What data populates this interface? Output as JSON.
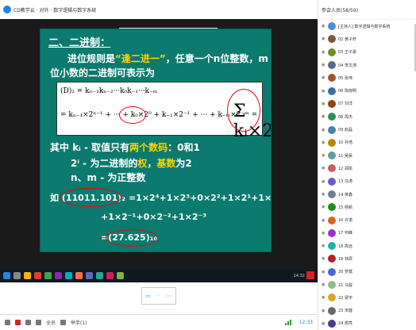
{
  "window": {
    "title": "CD教学云 · 对外 · 数字逻辑与数字系统"
  },
  "slide_header": {
    "left": "放映幻灯片",
    "mid": "课件",
    "right": "屏幕共享·工具"
  },
  "slide": {
    "section_title": "二、二进制：",
    "rule_prefix": "进位规则是",
    "rule_highlight": "“逢二进一”",
    "rule_suffix": "，任意一个n位整数，m",
    "rule_line2": "位小数的二进制可表示为",
    "formula_line1": "(D)₂ = kₙ₋₁kₙ₋₂···k₀k₋₁···k₋ₘ",
    "formula_line2": "= kₙ₋₁×2ⁿ⁻¹ + ··· + k₀×2⁰ + k₋₁×2⁻¹ + ··· + k₋ₘ×2⁻ᵐ =",
    "formula_sum": "Σ kᵢ×2ⁱ",
    "where_prefix": "其中",
    "where_ki": "kᵢ - 取值只有",
    "where_two_digits": "两个数码",
    "where_digits": "：0和1",
    "line3_a": "2ⁱ - 为二进制的",
    "line3_weight": "权",
    "line3_sep": "，",
    "line3_base": "基数",
    "line3_end": "为2",
    "line4": "n、m - 为正整数",
    "example_prefix": "如",
    "example_line1": "(11011.101)₂ =1×2⁴+1×2³+0×2²+1×2¹+1×2⁰",
    "example_line2": "+1×2⁻¹+0×2⁻²+1×2⁻³",
    "example_line3": "=(27.625)₁₀"
  },
  "taskbar": {
    "clock": "14:32"
  },
  "share_bar": {
    "left": "▭",
    "mid": "·",
    "right": "⋯"
  },
  "bottombar": {
    "label1": "全员",
    "label2": "举手(1)",
    "time": "12:33"
  },
  "sidebar": {
    "header": "参会人员(58/59)",
    "members": [
      {
        "name": "[主持人] 数字逻辑与数字系统",
        "color": "#4a90d9"
      },
      {
        "name": "02 黄子轩",
        "color": "#7a5a3a"
      },
      {
        "name": "03 王子豪",
        "color": "#6b8e23"
      },
      {
        "name": "04 李文涛",
        "color": "#556b8e"
      },
      {
        "name": "05 张伟",
        "color": "#a0522d"
      },
      {
        "name": "06 陈晓明",
        "color": "#3a6ea5"
      },
      {
        "name": "07 刘洋",
        "color": "#8b4513"
      },
      {
        "name": "08 周杰",
        "color": "#2e8b57"
      },
      {
        "name": "09 赵磊",
        "color": "#4682b4"
      },
      {
        "name": "10 孙浩",
        "color": "#b8860b"
      },
      {
        "name": "11 吴昊",
        "color": "#5f9ea0"
      },
      {
        "name": "12 郑凯",
        "color": "#cd5c5c"
      },
      {
        "name": "13 冯涛",
        "color": "#6a5acd"
      },
      {
        "name": "14 蒋鑫",
        "color": "#708090"
      },
      {
        "name": "15 杨帆",
        "color": "#228b22"
      },
      {
        "name": "16 许诺",
        "color": "#d2691e"
      },
      {
        "name": "17 何峰",
        "color": "#9932cc"
      },
      {
        "name": "18 高远",
        "color": "#20b2aa"
      },
      {
        "name": "19 林辰",
        "color": "#b22222"
      },
      {
        "name": "20 罗斌",
        "color": "#4169e1"
      },
      {
        "name": "21 马骏",
        "color": "#8fbc8f"
      },
      {
        "name": "22 梁宇",
        "color": "#daa520"
      },
      {
        "name": "23 宋健",
        "color": "#696969"
      },
      {
        "name": "24 唐亮",
        "color": "#483d8b"
      }
    ]
  }
}
